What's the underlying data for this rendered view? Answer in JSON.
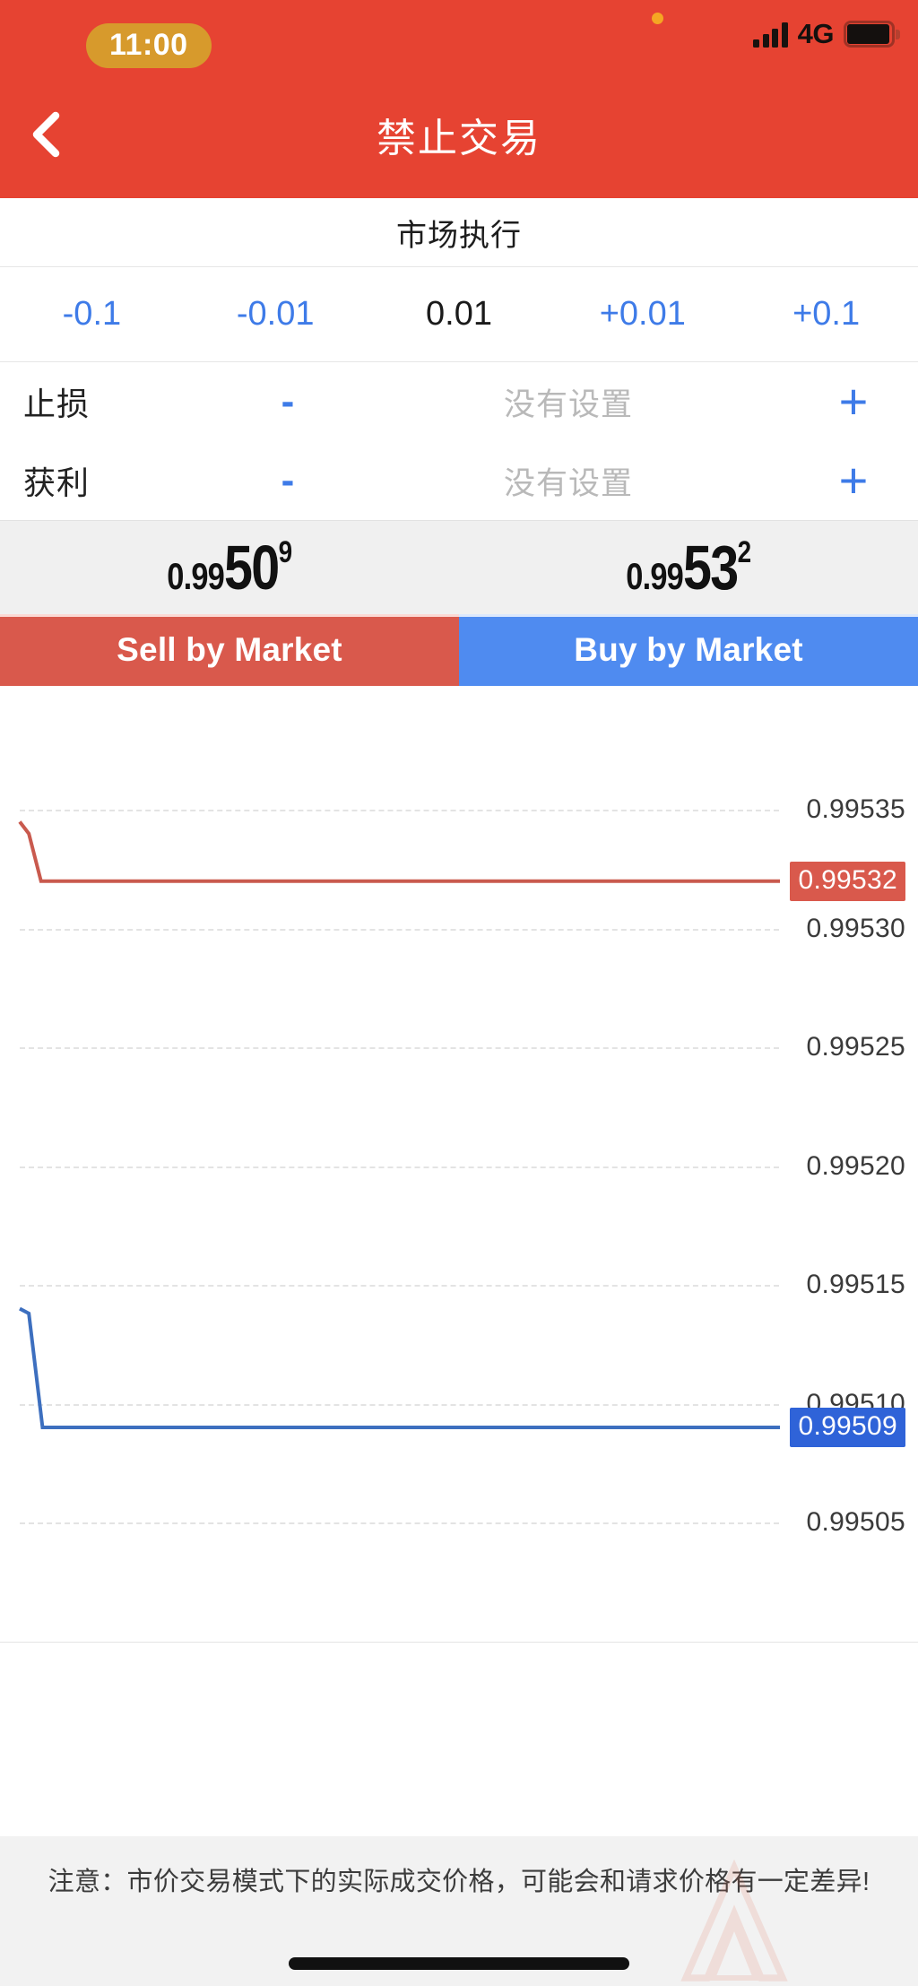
{
  "status_bar": {
    "time": "11:00",
    "network": "4G",
    "signal_icon": "signal-bars-icon",
    "battery_icon": "battery-icon",
    "recording_dot_icon": "recording-dot-icon"
  },
  "nav": {
    "title": "禁止交易",
    "back_icon": "back-chevron-icon"
  },
  "execution": {
    "mode_label": "市场执行"
  },
  "volume": {
    "steps": [
      {
        "label": "-0.1",
        "name": "volume-minus-0.1",
        "active": false
      },
      {
        "label": "-0.01",
        "name": "volume-minus-0.01",
        "active": false
      },
      {
        "label": "0.01",
        "name": "volume-current",
        "active": true
      },
      {
        "label": "+0.01",
        "name": "volume-plus-0.01",
        "active": false
      },
      {
        "label": "+0.1",
        "name": "volume-plus-0.1",
        "active": false
      }
    ]
  },
  "stop_loss": {
    "label": "止损",
    "value": "没有设置",
    "minus": "-",
    "plus": "+"
  },
  "take_profit": {
    "label": "获利",
    "value": "没有设置",
    "minus": "-",
    "plus": "+"
  },
  "quote": {
    "bid": {
      "prefix": "0.99",
      "main": "50",
      "sup": "9"
    },
    "ask": {
      "prefix": "0.99",
      "main": "53",
      "sup": "2"
    }
  },
  "actions": {
    "sell_label": "Sell by Market",
    "buy_label": "Buy by Market"
  },
  "notice": {
    "text": "注意：市价交易模式下的实际成交价格，可能会和请求价格有一定差异!"
  },
  "colors": {
    "header_red": "#E64332",
    "sell_red": "#D9594C",
    "buy_blue": "#4F8BF0",
    "accent_blue": "#3E7BE8",
    "ask_line": "#C95A4E",
    "bid_line": "#3D6FBF",
    "time_badge": "#D79A2C"
  },
  "chart_data": {
    "type": "line",
    "title": "",
    "xlabel": "",
    "ylabel": "",
    "ylim": [
      0.99503,
      0.995375
    ],
    "grid": true,
    "legend_position": "none",
    "yticks": [
      "0.99535",
      "0.99530",
      "0.99525",
      "0.99520",
      "0.99515",
      "0.99510",
      "0.99505"
    ],
    "ytick_values": [
      0.99535,
      0.9953,
      0.99525,
      0.9952,
      0.99515,
      0.9951,
      0.99505
    ],
    "series": [
      {
        "name": "ask",
        "color": "#C95A4E",
        "current_value": 0.99532,
        "current_label": "0.99532",
        "x": [
          0.0,
          0.012,
          0.028,
          1.0
        ],
        "values": [
          0.995345,
          0.99534,
          0.99532,
          0.99532
        ]
      },
      {
        "name": "bid",
        "color": "#3D6FBF",
        "current_value": 0.99509,
        "current_label": "0.99509",
        "x": [
          0.0,
          0.012,
          0.03,
          1.0
        ],
        "values": [
          0.99514,
          0.995138,
          0.99509,
          0.99509
        ]
      }
    ]
  }
}
